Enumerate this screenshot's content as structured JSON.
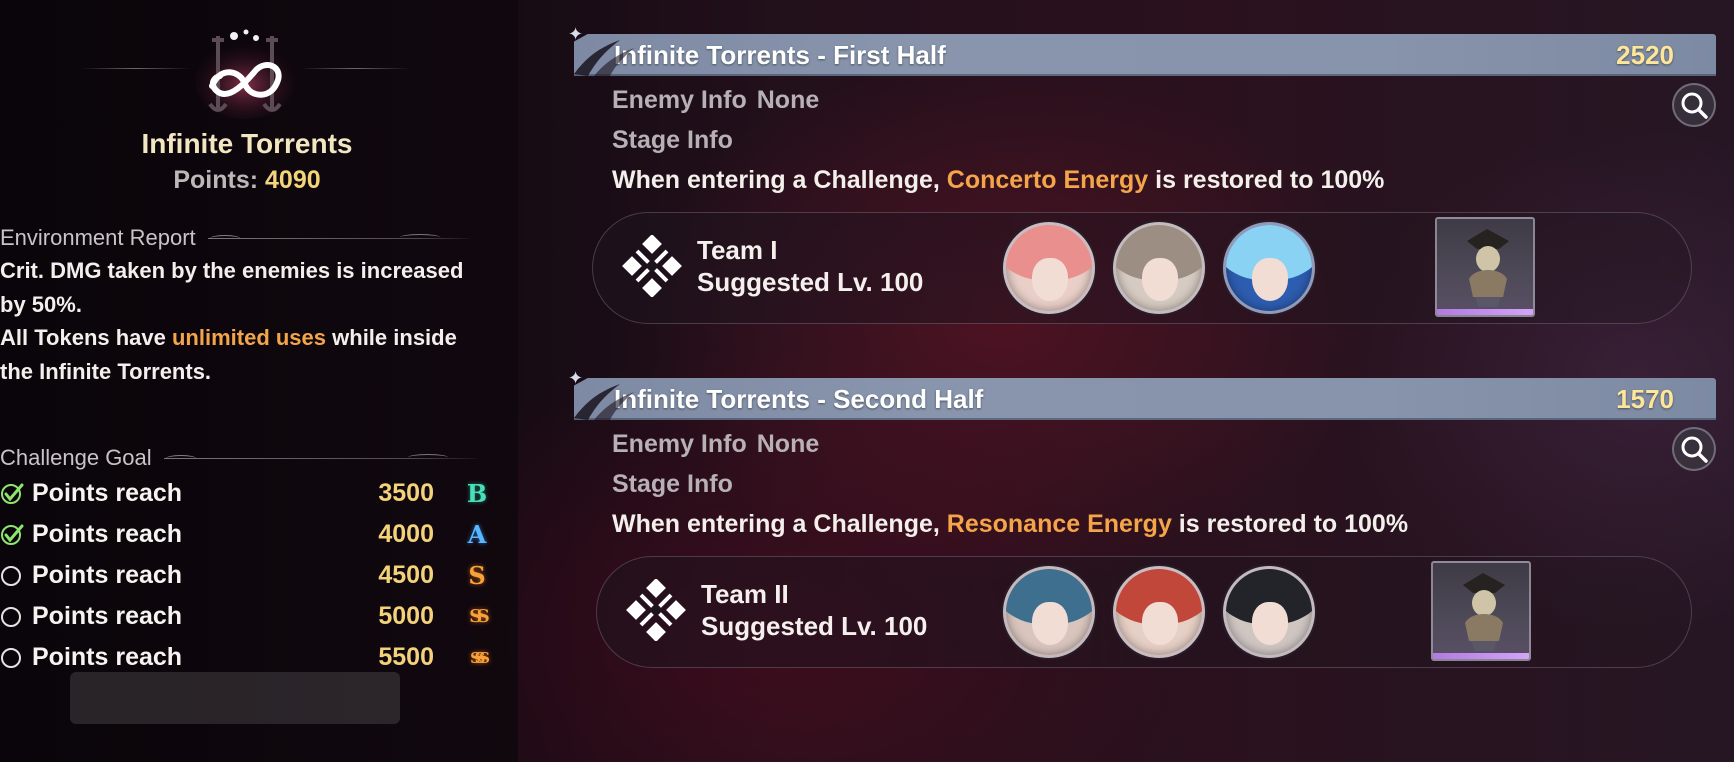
{
  "left_panel": {
    "tower_name": "Infinite Torrents",
    "points_label": "Points:",
    "points_value": "4090",
    "environment": {
      "heading": "Environment Report",
      "line1": "Crit. DMG taken by the enemies is increased by 50%.",
      "line2_pre": "All Tokens have ",
      "line2_highlight": "unlimited uses",
      "line2_post": " while inside the Infinite Torrents."
    },
    "challenge": {
      "heading": "Challenge Goal",
      "goals": [
        {
          "label": "Points reach",
          "points": "3500",
          "grade": "B",
          "achieved": true
        },
        {
          "label": "Points reach",
          "points": "4000",
          "grade": "A",
          "achieved": true
        },
        {
          "label": "Points reach",
          "points": "4500",
          "grade": "S",
          "achieved": false
        },
        {
          "label": "Points reach",
          "points": "5000",
          "grade": "SS",
          "achieved": false
        },
        {
          "label": "Points reach",
          "points": "5500",
          "grade": "SSS",
          "achieved": false
        }
      ]
    }
  },
  "stages": [
    {
      "title": "Infinite Torrents - First Half",
      "score": "2520",
      "enemy_label": "Enemy Info",
      "enemy_value": "None",
      "stage_label": "Stage Info",
      "desc_pre": "When entering a Challenge, ",
      "desc_highlight": "Concerto Energy",
      "desc_post": " is restored to 100%",
      "team": {
        "name": "Team I",
        "level": "Suggested Lv. 100"
      }
    },
    {
      "title": "Infinite Torrents - Second Half",
      "score": "1570",
      "enemy_label": "Enemy Info",
      "enemy_value": "None",
      "stage_label": "Stage Info",
      "desc_pre": "When entering a Challenge, ",
      "desc_highlight": "Resonance Energy",
      "desc_post": " is restored to 100%",
      "team": {
        "name": "Team II",
        "level": "Suggested Lv. 100"
      }
    }
  ],
  "colors": {
    "highlight": "#f4a54a",
    "score": "#fde59a",
    "points": "#f2d47b",
    "banner": "#8592ab"
  },
  "icons": [
    "tower-emblem-icon",
    "check-icon",
    "empty-circle-icon",
    "search-icon",
    "team-formation-icon",
    "character-portrait",
    "echo-bust-icon"
  ]
}
